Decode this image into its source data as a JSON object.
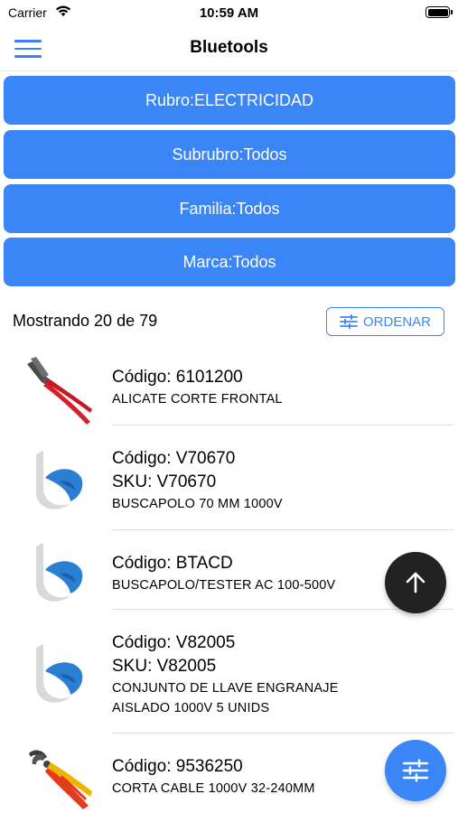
{
  "status_bar": {
    "carrier": "Carrier",
    "time": "10:59 AM"
  },
  "nav": {
    "title": "Bluetools",
    "menu_icon": "hamburger-menu-icon"
  },
  "filters": [
    {
      "label": "Rubro:ELECTRICIDAD"
    },
    {
      "label": "Subrubro:Todos"
    },
    {
      "label": "Familia:Todos"
    },
    {
      "label": "Marca:Todos"
    }
  ],
  "results": {
    "count_text": "Mostrando 20 de 79",
    "sort_label": "ORDENAR",
    "sort_icon": "sliders-icon"
  },
  "products": [
    {
      "code": "Código: 6101200",
      "sku": "",
      "description": [
        "ALICATE CORTE FRONTAL"
      ],
      "image": "pliers-image"
    },
    {
      "code": "Código: V70670",
      "sku": "SKU: V70670",
      "description": [
        "BUSCAPOLO 70 MM 1000V"
      ],
      "image": "bluetools-logo-placeholder"
    },
    {
      "code": "Código: BTACD",
      "sku": "",
      "description": [
        "BUSCAPOLO/TESTER AC 100-500V"
      ],
      "image": "bluetools-logo-placeholder"
    },
    {
      "code": "Código: V82005",
      "sku": "SKU: V82005",
      "description": [
        "CONJUNTO DE LLAVE ENGRANAJE",
        "AISLADO 1000V 5 UNIDS"
      ],
      "image": "bluetools-logo-placeholder"
    },
    {
      "code": "Código: 9536250",
      "sku": "",
      "description": [
        "CORTA CABLE 1000V 32-240MM"
      ],
      "image": "cable-cutter-image"
    }
  ],
  "fabs": {
    "scroll_top_icon": "arrow-up-icon",
    "filter_icon": "sliders-icon"
  },
  "colors": {
    "accent": "#3b86f7",
    "fab_dark": "#222222",
    "text": "#000000",
    "divider": "#dcdcdc"
  }
}
